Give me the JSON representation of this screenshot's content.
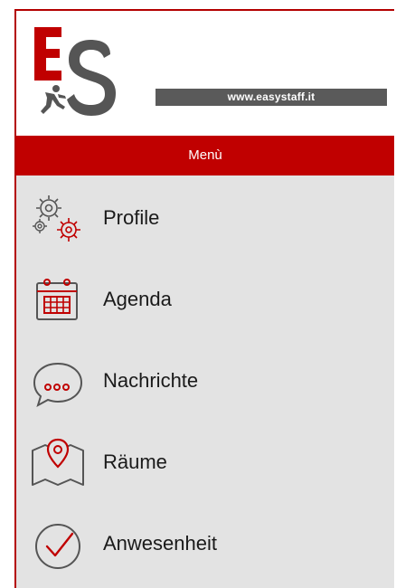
{
  "header": {
    "logo": {
      "text": "ES",
      "icon": "running-person-logo-icon"
    },
    "url": "www.easystaff.it"
  },
  "menu_bar": {
    "title": "Menù"
  },
  "menu": {
    "items": [
      {
        "label": "Profile",
        "icon": "gears-icon"
      },
      {
        "label": "Agenda",
        "icon": "calendar-icon"
      },
      {
        "label": "Nachrichte",
        "icon": "chat-bubble-icon"
      },
      {
        "label": "Räume",
        "icon": "map-pin-icon"
      },
      {
        "label": "Anwesenheit",
        "icon": "checkmark-circle-icon"
      }
    ]
  },
  "colors": {
    "brand_red": "#c00000",
    "icon_gray": "#555555",
    "menu_background": "#e3e3e3",
    "url_bar": "#5a5a5a"
  }
}
